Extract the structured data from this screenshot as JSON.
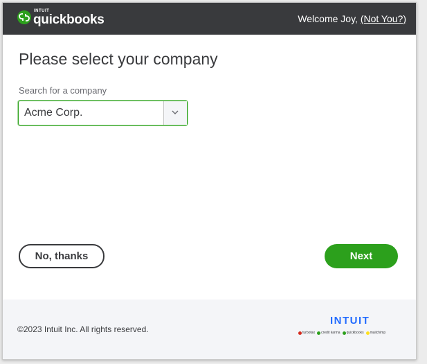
{
  "header": {
    "logo": {
      "intuit": "INTUIT",
      "word": "quickbooks",
      "icon": "quickbooks-logo-icon"
    },
    "welcome_prefix": "Welcome Joy, ",
    "not_you": "(Not You?)"
  },
  "main": {
    "title": "Please select your company",
    "search_label": "Search for a company",
    "selected_company": "Acme Corp.",
    "dropdown_icon": "chevron-down-icon"
  },
  "actions": {
    "secondary_label": "No, thanks",
    "primary_label": "Next"
  },
  "footer": {
    "copyright": "©2023 Intuit Inc. All rights reserved.",
    "brand": "INTUIT",
    "brands": [
      {
        "name": "turbotax",
        "color": "#d52b1e"
      },
      {
        "name": "credit karma",
        "color": "#2ca01c"
      },
      {
        "name": "quickbooks",
        "color": "#2ca01c"
      },
      {
        "name": "mailchimp",
        "color": "#ffe01b"
      }
    ]
  },
  "colors": {
    "header_bg": "#393a3d",
    "accent_green": "#2ca01c",
    "intuit_blue": "#236cff",
    "footer_bg": "#f4f5f8"
  }
}
